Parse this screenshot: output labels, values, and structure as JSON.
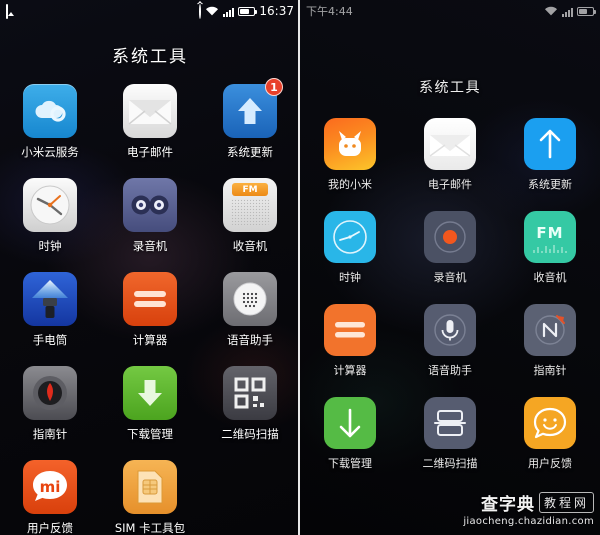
{
  "left_screen": {
    "statusbar": {
      "notification_icon": "image-icon",
      "alarm_icon": "alarm-icon",
      "wifi_icon": "wifi-icon",
      "signal_icon": "signal-icon",
      "battery_icon": "battery-icon",
      "time": "16:37"
    },
    "folder_title": "系统工具",
    "apps": [
      {
        "label": "小米云服务",
        "icon": "cloud-icon",
        "badge": ""
      },
      {
        "label": "电子邮件",
        "icon": "mail-icon",
        "badge": ""
      },
      {
        "label": "系统更新",
        "icon": "system-update-icon",
        "badge": "1"
      },
      {
        "label": "时钟",
        "icon": "clock-icon",
        "badge": ""
      },
      {
        "label": "录音机",
        "icon": "recorder-icon",
        "badge": ""
      },
      {
        "label": "收音机",
        "icon": "fm-radio-icon",
        "badge": ""
      },
      {
        "label": "手电筒",
        "icon": "flashlight-icon",
        "badge": ""
      },
      {
        "label": "计算器",
        "icon": "calculator-icon",
        "badge": ""
      },
      {
        "label": "语音助手",
        "icon": "voice-assistant-icon",
        "badge": ""
      },
      {
        "label": "指南针",
        "icon": "compass-icon",
        "badge": ""
      },
      {
        "label": "下载管理",
        "icon": "download-icon",
        "badge": ""
      },
      {
        "label": "二维码扫描",
        "icon": "qr-scan-icon",
        "badge": ""
      },
      {
        "label": "用户反馈",
        "icon": "feedback-icon",
        "badge": ""
      },
      {
        "label": "SIM 卡工具包",
        "icon": "sim-toolkit-icon",
        "badge": ""
      }
    ]
  },
  "right_screen": {
    "statusbar": {
      "time": "下午4:44",
      "wifi_icon": "wifi-icon",
      "signal_icon": "signal-icon",
      "battery_icon": "battery-icon"
    },
    "folder_title": "系统工具",
    "apps": [
      {
        "label": "我的小米",
        "icon": "mi-bunny-icon"
      },
      {
        "label": "电子邮件",
        "icon": "mail-icon"
      },
      {
        "label": "系统更新",
        "icon": "system-update-icon"
      },
      {
        "label": "时钟",
        "icon": "clock-icon"
      },
      {
        "label": "录音机",
        "icon": "recorder-icon"
      },
      {
        "label": "收音机",
        "icon": "fm-radio-icon"
      },
      {
        "label": "计算器",
        "icon": "calculator-icon"
      },
      {
        "label": "语音助手",
        "icon": "voice-assistant-icon"
      },
      {
        "label": "指南针",
        "icon": "compass-icon"
      },
      {
        "label": "下载管理",
        "icon": "download-icon"
      },
      {
        "label": "二维码扫描",
        "icon": "qr-scan-icon"
      },
      {
        "label": "用户反馈",
        "icon": "feedback-icon"
      }
    ]
  },
  "watermark": {
    "main": "查字典",
    "boxed": "教程网",
    "url": "jiaocheng.chazidian.com"
  },
  "colors": {
    "accent_blue": "#1b9ff0",
    "accent_orange": "#f2732c",
    "accent_green": "#55bb45",
    "badge_red": "#e8402a"
  }
}
